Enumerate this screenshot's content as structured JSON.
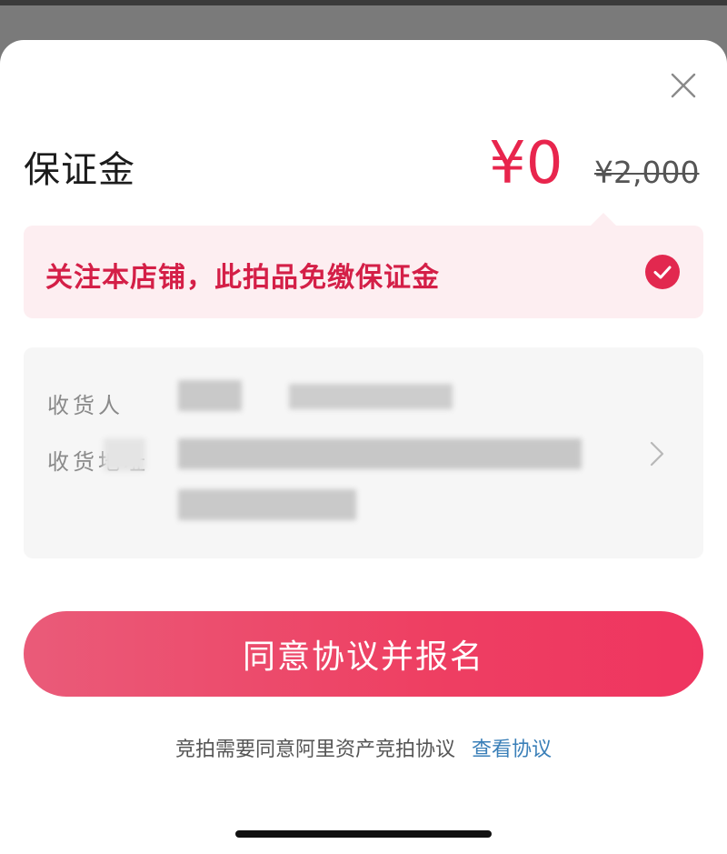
{
  "sheet": {
    "title": "保证金",
    "price_now": "¥0",
    "price_original": "¥2,000",
    "close_icon": "close-icon"
  },
  "promo": {
    "text": "关注本店铺，此拍品免缴保证金",
    "checked": true,
    "check_icon": "check-circle-icon"
  },
  "address": {
    "recipient_label": "收货人",
    "address_label": "收货地址",
    "chevron_icon": "chevron-right-icon"
  },
  "cta": {
    "label": "同意协议并报名"
  },
  "footer": {
    "notice": "竞拍需要同意阿里资产竞拍协议",
    "link": "查看协议"
  },
  "colors": {
    "accent": "#e8254d",
    "promo_bg": "#fdeef1",
    "link": "#3a7fb8"
  }
}
